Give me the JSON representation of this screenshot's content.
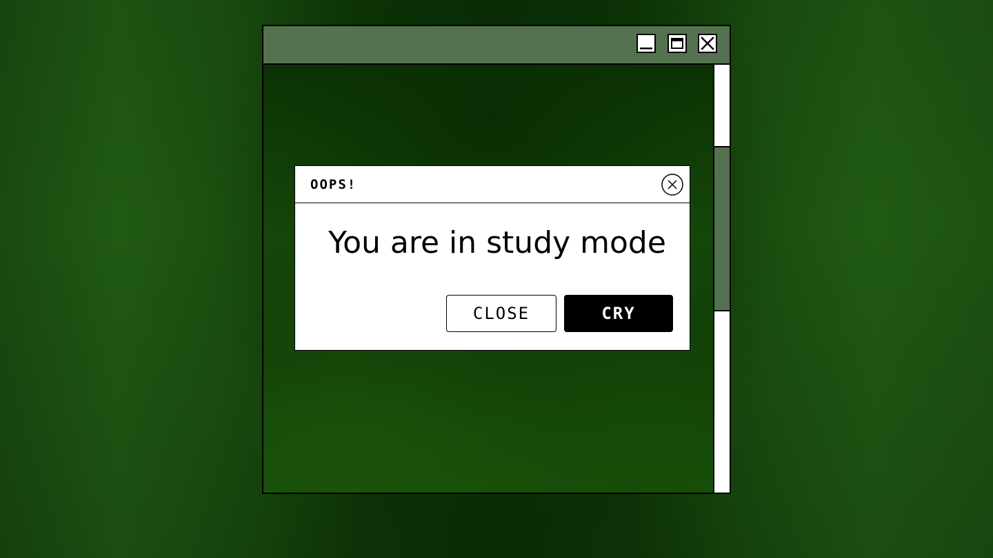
{
  "window": {
    "controls": {
      "minimize_icon": "minimize-icon",
      "maximize_icon": "maximize-icon",
      "close_icon": "close-icon"
    },
    "colors": {
      "titlebar": "#557250",
      "scroll_thumb": "#557250",
      "scroll_track": "#ffffff"
    }
  },
  "dialog": {
    "title": "OOPS!",
    "close_icon": "circle-x-icon",
    "message": "You are in study mode",
    "buttons": {
      "close_label": "CLOSE",
      "cry_label": "CRY"
    }
  }
}
